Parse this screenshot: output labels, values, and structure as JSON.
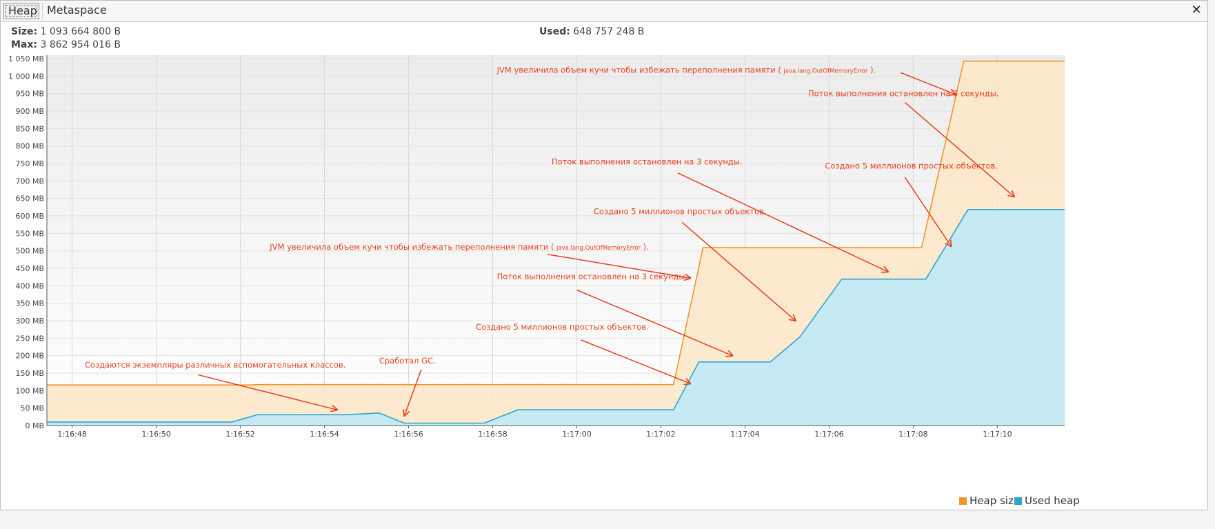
{
  "tabs": [
    {
      "label": "Heap",
      "active": true
    },
    {
      "label": "Metaspace",
      "active": false
    }
  ],
  "close_icon": "close-icon",
  "info": {
    "size_label": "Size:",
    "size_value": "1 093 664 800 B",
    "max_label": "Max:",
    "max_value": "3 862 954 016 B",
    "used_label": "Used:",
    "used_value": "648 757 248 B"
  },
  "colors": {
    "heap_line": "#f0952b",
    "heap_fill": "#fde6c7",
    "used_line": "#2aa5cf",
    "used_fill": "#bfeaf7",
    "annotation": "#e8401c"
  },
  "chart_data": {
    "type": "area",
    "y_ticks": [
      "0 MB",
      "50 MB",
      "100 MB",
      "150 MB",
      "200 MB",
      "250 MB",
      "300 MB",
      "350 MB",
      "400 MB",
      "450 MB",
      "500 MB",
      "550 MB",
      "600 MB",
      "650 MB",
      "700 MB",
      "750 MB",
      "800 MB",
      "850 MB",
      "900 MB",
      "950 MB",
      "1 000 MB",
      "1 050 MB"
    ],
    "y_tick_values": [
      0,
      50,
      100,
      150,
      200,
      250,
      300,
      350,
      400,
      450,
      500,
      550,
      600,
      650,
      700,
      750,
      800,
      850,
      900,
      950,
      1000,
      1050
    ],
    "ylim": [
      0,
      1060
    ],
    "x_ticks": [
      "1:16:48",
      "1:16:50",
      "1:16:52",
      "1:16:54",
      "1:16:56",
      "1:16:58",
      "1:17:00",
      "1:17:02",
      "1:17:04",
      "1:17:06",
      "1:17:08",
      "1:17:10"
    ],
    "x_tick_values": [
      0,
      2,
      4,
      6,
      8,
      10,
      12,
      14,
      16,
      18,
      20,
      22
    ],
    "xlim": [
      -0.6,
      23.6
    ],
    "grid": true,
    "legend_position": "bottom-right",
    "series": [
      {
        "name": "Heap size",
        "points": [
          [
            -0.6,
            116
          ],
          [
            4.2,
            116
          ],
          [
            4.4,
            117
          ],
          [
            14.3,
            117
          ],
          [
            15.0,
            509
          ],
          [
            20.2,
            509
          ],
          [
            21.2,
            1043
          ],
          [
            23.6,
            1043
          ]
        ]
      },
      {
        "name": "Used heap",
        "points": [
          [
            -0.6,
            10
          ],
          [
            3.8,
            10
          ],
          [
            4.4,
            31
          ],
          [
            6.5,
            31
          ],
          [
            7.3,
            36
          ],
          [
            7.9,
            7
          ],
          [
            9.8,
            7
          ],
          [
            10.6,
            45
          ],
          [
            14.3,
            45
          ],
          [
            14.9,
            182
          ],
          [
            16.6,
            182
          ],
          [
            17.3,
            253
          ],
          [
            18.3,
            419
          ],
          [
            20.3,
            419
          ],
          [
            21.3,
            618
          ],
          [
            23.6,
            618
          ]
        ]
      }
    ],
    "annotations": [
      {
        "text": "JVM увеличила объем кучи чтобы избежать переполнения памяти (",
        "small": "java.lang.OutOfMemoryError",
        "tail": ").",
        "x": 10.1,
        "y": 1010,
        "arrow_from": [
          19.7,
          1010
        ],
        "arrow_to": [
          21.0,
          948
        ]
      },
      {
        "text": "Поток выполнения остановлен на 3 секунды.",
        "x": 17.5,
        "y": 943,
        "arrow_from": [
          19.8,
          925
        ],
        "arrow_to": [
          22.4,
          655
        ]
      },
      {
        "text": "Поток выполнения остановлен на 3 секунды.",
        "x": 11.4,
        "y": 747,
        "arrow_from": [
          14.4,
          723
        ],
        "arrow_to": [
          19.4,
          440
        ]
      },
      {
        "text": "Создано 5 миллионов простых объектов.",
        "x": 17.9,
        "y": 735,
        "arrow_from": [
          19.8,
          711
        ],
        "arrow_to": [
          20.9,
          513
        ]
      },
      {
        "text": "Создано 5 миллионов простых объектов.",
        "x": 12.4,
        "y": 605,
        "arrow_from": [
          14.5,
          582
        ],
        "arrow_to": [
          17.2,
          300
        ]
      },
      {
        "text": "JVM увеличила объем кучи чтобы избежать переполнения памяти (",
        "small": "java.lang.OutOfMemoryError",
        "tail": ").",
        "x": 4.7,
        "y": 503,
        "arrow_from": [
          11.3,
          490
        ],
        "arrow_to": [
          14.7,
          422
        ]
      },
      {
        "text": "Поток выполнения остановлен на 3 секунды.",
        "x": 10.1,
        "y": 418,
        "arrow_from": [
          12.0,
          388
        ],
        "arrow_to": [
          15.7,
          200
        ]
      },
      {
        "text": "Создано 5 миллионов простых объектов.",
        "x": 9.6,
        "y": 274,
        "arrow_from": [
          12.1,
          245
        ],
        "arrow_to": [
          14.7,
          120
        ]
      },
      {
        "text": "Создаются экземпляры различных вспомогательных классов.",
        "x": 0.3,
        "y": 166,
        "arrow_from": [
          3.0,
          145
        ],
        "arrow_to": [
          6.3,
          45
        ]
      },
      {
        "text": "Сработал GC.",
        "x": 7.3,
        "y": 178,
        "arrow_from": [
          8.3,
          160
        ],
        "arrow_to": [
          7.9,
          28
        ]
      }
    ]
  },
  "legend": [
    {
      "label": "Heap size",
      "color": "#f0952b"
    },
    {
      "label": "Used heap",
      "color": "#2aa5cf"
    }
  ]
}
